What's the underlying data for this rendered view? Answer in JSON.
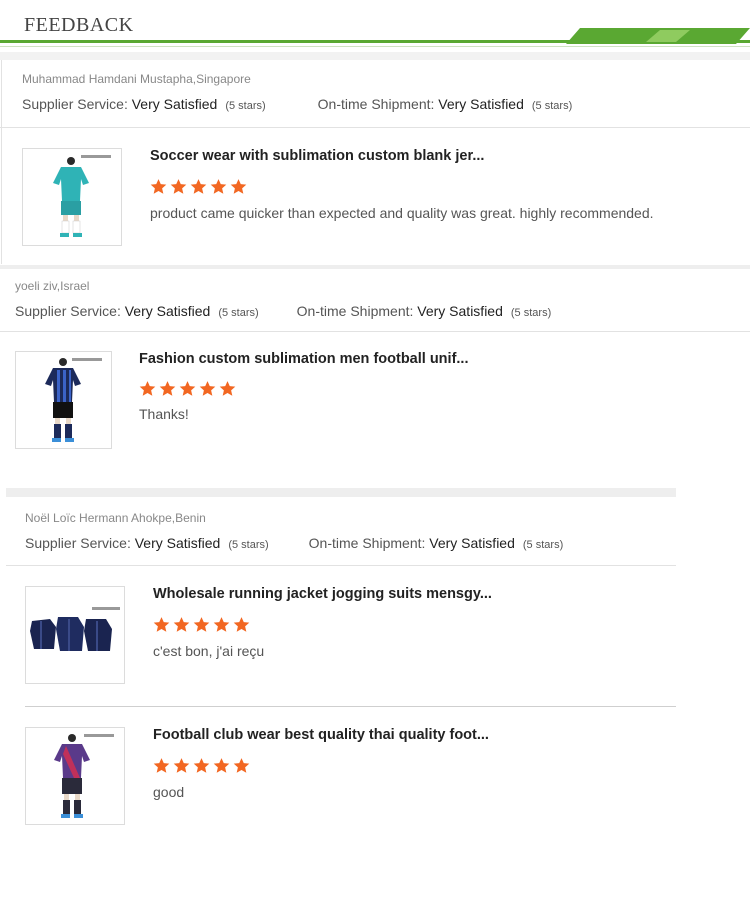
{
  "page": {
    "title": "FEEDBACK"
  },
  "colors": {
    "accent_green": "#5aa832",
    "star_orange": "#f26722"
  },
  "ratings_labels": {
    "supplier_service": "Supplier Service:",
    "shipment": "On-time Shipment:"
  },
  "reviews": [
    {
      "reviewer": "Muhammad Hamdani Mustapha,Singapore",
      "supplier_value": "Very Satisfied",
      "supplier_stars": "(5 stars)",
      "shipment_value": "Very Satisfied",
      "shipment_stars": "(5 stars)",
      "items": [
        {
          "title": "Soccer wear with sublimation custom blank jer...",
          "rating": 5,
          "comment": "product came quicker than expected and quality was great. highly recommended."
        }
      ]
    },
    {
      "reviewer": "yoeli ziv,Israel",
      "supplier_value": "Very Satisfied",
      "supplier_stars": "(5 stars)",
      "shipment_value": "Very Satisfied",
      "shipment_stars": "(5 stars)",
      "items": [
        {
          "title": "Fashion custom sublimation men football unif...",
          "rating": 5,
          "comment": "Thanks!"
        }
      ]
    },
    {
      "reviewer": "Noël Loïc Hermann Ahokpe,Benin",
      "supplier_value": "Very Satisfied",
      "supplier_stars": "(5 stars)",
      "shipment_value": "Very Satisfied",
      "shipment_stars": "(5 stars)",
      "items": [
        {
          "title": "Wholesale running jacket jogging suits mensgy...",
          "rating": 5,
          "comment": "c'est bon, j'ai reçu"
        },
        {
          "title": "Football club wear best quality thai quality foot...",
          "rating": 5,
          "comment": "good"
        }
      ]
    }
  ]
}
